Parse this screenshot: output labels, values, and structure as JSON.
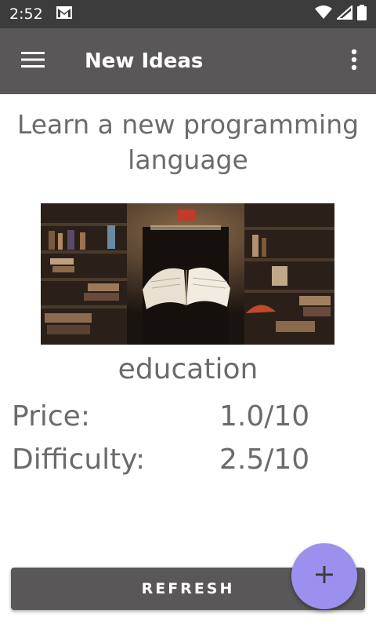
{
  "status_bar": {
    "time": "2:52",
    "notification_icon": "gmail-icon",
    "icons": [
      "wifi-icon",
      "cell-signal-icon",
      "battery-icon"
    ]
  },
  "app_bar": {
    "title": "New Ideas",
    "menu_icon": "menu-icon",
    "overflow_icon": "more-vert-icon"
  },
  "idea": {
    "title": "Learn a new programming language",
    "image_description": "book-in-library-image",
    "category": "education",
    "price_label": "Price:",
    "price_value": "1.0/10",
    "difficulty_label": "Difficulty:",
    "difficulty_value": "2.5/10"
  },
  "actions": {
    "refresh_label": "REFRESH",
    "fab_icon": "add-icon"
  },
  "colors": {
    "app_bar": "#5a5758",
    "status_bar": "#3c3c3c",
    "text": "#6b6b6b",
    "fab": "#9c90ef"
  }
}
